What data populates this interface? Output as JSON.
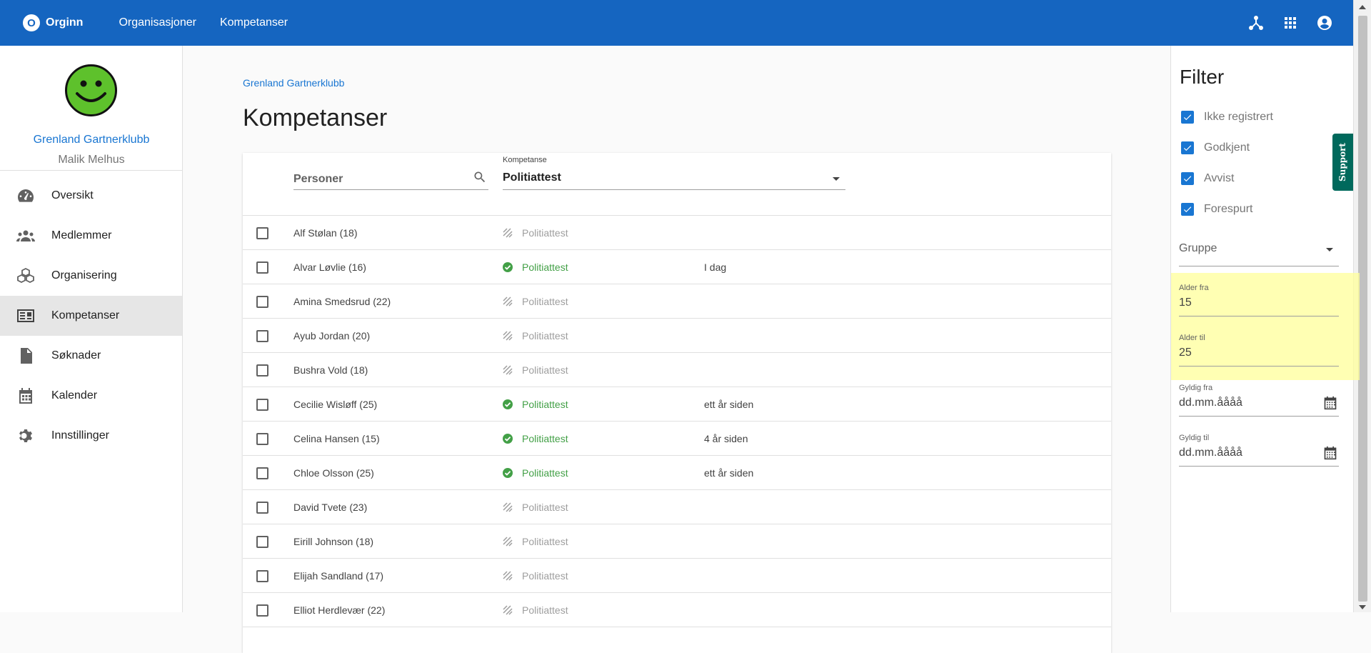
{
  "app": {
    "logo_letter": "O",
    "logo_text": "Orginn"
  },
  "nav": {
    "items": [
      "Organisasjoner",
      "Kompetanser"
    ]
  },
  "sidebar": {
    "org_name": "Grenland Gartnerklubb",
    "user_name": "Malik Melhus",
    "items": [
      {
        "label": "Oversikt",
        "icon": "speedometer-icon"
      },
      {
        "label": "Medlemmer",
        "icon": "people-icon"
      },
      {
        "label": "Organisering",
        "icon": "boxes-icon"
      },
      {
        "label": "Kompetanser",
        "icon": "id-card-icon",
        "active": true
      },
      {
        "label": "Søknader",
        "icon": "document-icon"
      },
      {
        "label": "Kalender",
        "icon": "calendar-icon"
      },
      {
        "label": "Innstillinger",
        "icon": "gear-icon"
      }
    ]
  },
  "main": {
    "breadcrumb": "Grenland Gartnerklubb",
    "title": "Kompetanser",
    "search_placeholder": "Personer",
    "kompetanse_label": "Kompetanse",
    "kompetanse_value": "Politiattest",
    "rows": [
      {
        "person": "Alf Stølan (18)",
        "competence": "Politiattest",
        "status": "pending",
        "when": ""
      },
      {
        "person": "Alvar Løvlie (16)",
        "competence": "Politiattest",
        "status": "approved",
        "when": "I dag"
      },
      {
        "person": "Amina Smedsrud (22)",
        "competence": "Politiattest",
        "status": "pending",
        "when": ""
      },
      {
        "person": "Ayub Jordan (20)",
        "competence": "Politiattest",
        "status": "pending",
        "when": ""
      },
      {
        "person": "Bushra Vold (18)",
        "competence": "Politiattest",
        "status": "pending",
        "when": ""
      },
      {
        "person": "Cecilie Wisløff (25)",
        "competence": "Politiattest",
        "status": "approved",
        "when": "ett år siden"
      },
      {
        "person": "Celina Hansen (15)",
        "competence": "Politiattest",
        "status": "approved",
        "when": "4 år siden"
      },
      {
        "person": "Chloe Olsson (25)",
        "competence": "Politiattest",
        "status": "approved",
        "when": "ett år siden"
      },
      {
        "person": "David Tvete (23)",
        "competence": "Politiattest",
        "status": "pending",
        "when": ""
      },
      {
        "person": "Eirill Johnson (18)",
        "competence": "Politiattest",
        "status": "pending",
        "when": ""
      },
      {
        "person": "Elijah Sandland (17)",
        "competence": "Politiattest",
        "status": "pending",
        "when": ""
      },
      {
        "person": "Elliot Herdlevær (22)",
        "competence": "Politiattest",
        "status": "pending",
        "when": ""
      }
    ]
  },
  "filter": {
    "title": "Filter",
    "checkboxes": [
      {
        "label": "Ikke registrert",
        "checked": true
      },
      {
        "label": "Godkjent",
        "checked": true
      },
      {
        "label": "Avvist",
        "checked": true
      },
      {
        "label": "Forespurt",
        "checked": true
      }
    ],
    "group_placeholder": "Gruppe",
    "age_from_label": "Alder fra",
    "age_from_value": "15",
    "age_to_label": "Alder til",
    "age_to_value": "25",
    "valid_from_label": "Gyldig fra",
    "valid_from_placeholder": "dd.mm.åååå",
    "valid_to_label": "Gyldig til",
    "valid_to_placeholder": "dd.mm.åååå"
  },
  "support_label": "Support",
  "colors": {
    "primary": "#1565c0",
    "approved": "#43a047",
    "highlight": "#ffff99",
    "support": "#00695c"
  }
}
